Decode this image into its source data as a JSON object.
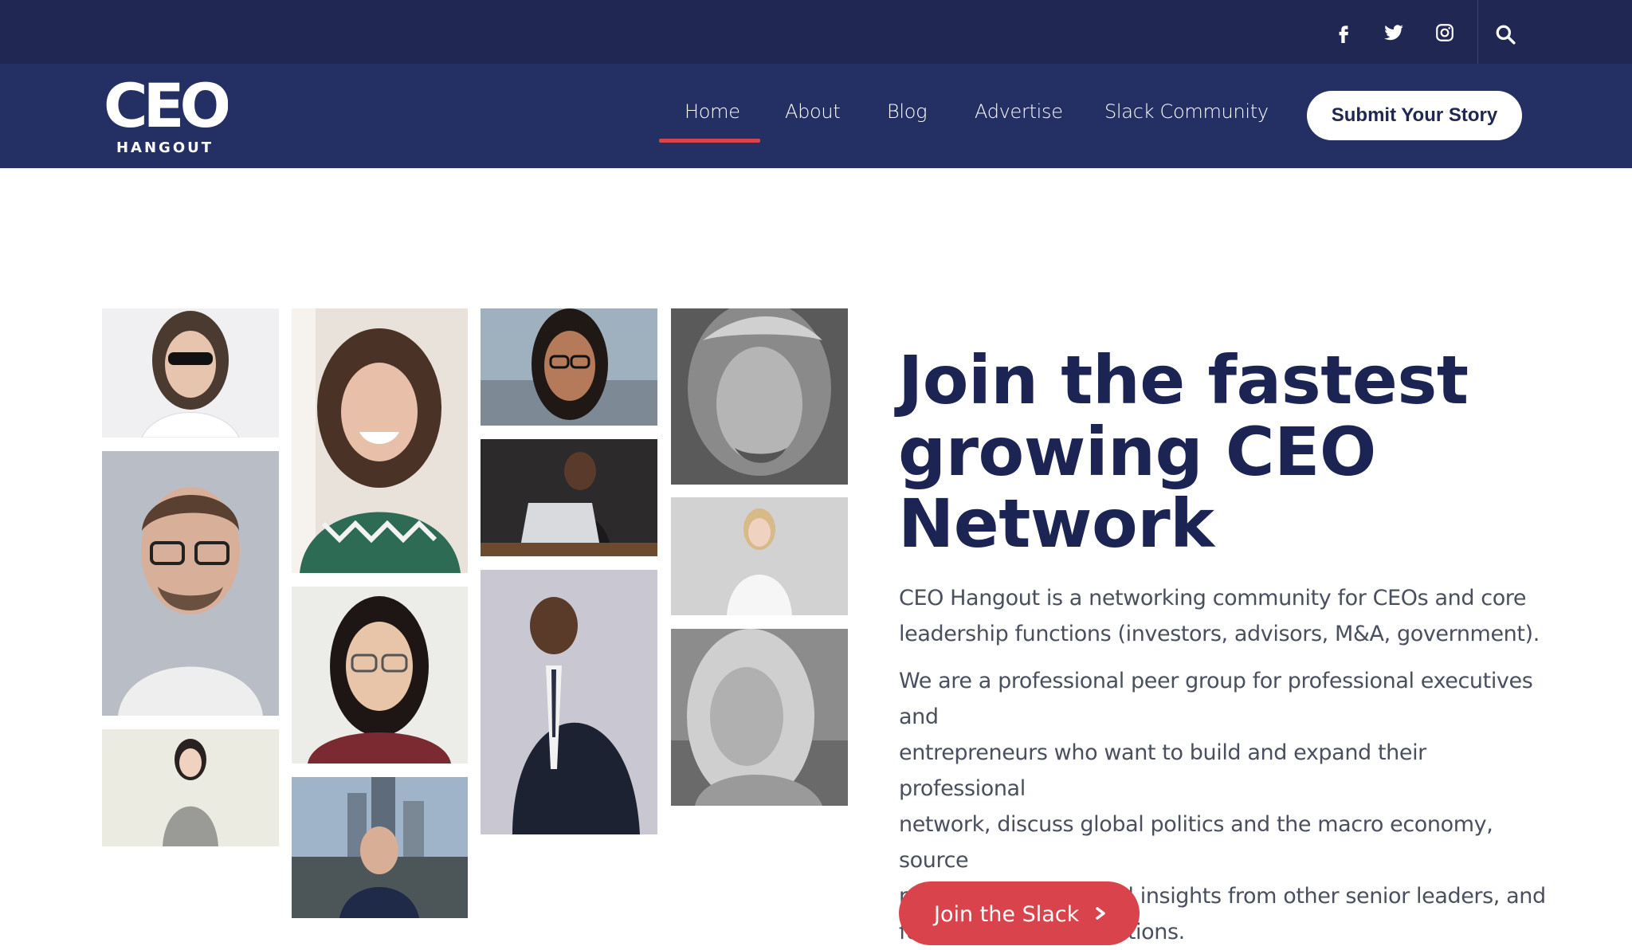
{
  "header": {
    "social": [
      {
        "name": "facebook-icon"
      },
      {
        "name": "twitter-icon"
      },
      {
        "name": "instagram-icon"
      }
    ],
    "search_icon": "search-icon"
  },
  "nav": {
    "logo_text": "CEO",
    "logo_subtext": "HANGOUT",
    "items": [
      {
        "label": "Home",
        "active": true
      },
      {
        "label": "About"
      },
      {
        "label": "Blog"
      },
      {
        "label": "Advertise"
      },
      {
        "label": "Slack Community"
      }
    ],
    "cta_label": "Submit Your Story"
  },
  "hero": {
    "headline_lines": [
      "Join the fastest",
      "growing CEO",
      "Network"
    ],
    "para1_lines": [
      "CEO Hangout is a networking community for CEOs and core",
      "leadership functions (investors, advisors, M&A, government)."
    ],
    "para2_lines": [
      "We are a professional peer group for professional executives and",
      "entrepreneurs who want to build and expand their professional",
      "network, discuss global politics and the macro economy, source",
      "real-time opinions and insights from other senior leaders, and",
      "form business connections."
    ],
    "cta_label": "Join the Slack"
  },
  "colors": {
    "topbar": "#1f2752",
    "navbar": "#243064",
    "accent": "#d9434b",
    "headline": "#1b2452"
  }
}
